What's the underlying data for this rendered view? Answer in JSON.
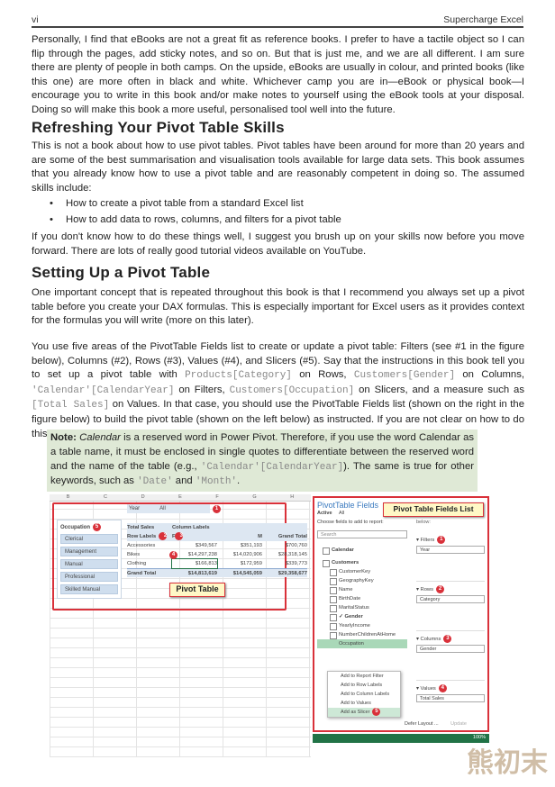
{
  "header": {
    "page": "vi",
    "book_title": "Supercharge Excel"
  },
  "intro_paragraph": "Personally, I find that eBooks are not a great fit as reference books. I prefer to have a tactile object so I can flip through the pages, add sticky notes, and so on. But that is just me, and we are all different. I am sure there are plenty of people in both camps. On the upside, eBooks are usually in colour, and printed books (like this one) are more often in black and white. Whichever camp you are in—eBook or physical book—I encourage you to write in this book and/or make notes to yourself using the eBook tools at your disposal. Doing so will make this book a more useful, personalised tool well into the future.",
  "section1": {
    "heading": "Refreshing Your Pivot Table Skills",
    "paragraph": "This is not a book about how to use pivot tables. Pivot tables have been around for more than 20 years and are some of the best summarisation and visualisation tools available for large data sets. This book assumes that you already know how to use a pivot table and are reasonably competent in doing so. The assumed skills include:",
    "bullets": [
      "How to create a pivot table from a standard Excel list",
      "How to add data to rows, columns, and filters for a pivot table"
    ],
    "paragraph2": "If you don't know how to do these things well, I suggest you brush up on your skills now before you move forward. There are lots of really good tutorial videos available on YouTube."
  },
  "section2": {
    "heading": "Setting Up a Pivot Table",
    "paragraph1": "One important concept that is repeated throughout this book is that I recommend you always set up a pivot table before you create your DAX formulas. This is especially important for Excel users as it provides context for the formulas you will write (more on this later).",
    "p2": {
      "a": "You use five areas of the PivotTable Fields list to create or update a pivot table: Filters (see #1 in the figure below), Columns (#2), Rows (#3), Values (#4), and Slicers (#5). Say that the instructions in this book tell you to set up a pivot table with ",
      "c1": "Products[Category]",
      "b": " on Rows, ",
      "c2": "Customers[Gender]",
      "c": " on Columns, ",
      "c3": "'Calendar'[CalendarYear]",
      "d": " on Filters, ",
      "c4": "Customers[Occupation]",
      "e": " on Slicers, and a measure such as ",
      "c5": "[Total Sales]",
      "f": " on Values. In that case, you should use the PivotTable Fields list (shown on the right in the figure below) to build the pivot table (shown on the left below) as instructed. If you are not clear on how to do this, then you should definitely brush up on building pivot tables before proceeding."
    }
  },
  "note": {
    "label": "Note:",
    "word": "Calendar",
    "a": " is a reserved word in Power Pivot. Therefore, if you use the word Calendar as a table name, it must be enclosed in single quotes to differentiate between the reserved word and the name of the table (e.g., ",
    "c1": "'Calendar'[CalendarYear]",
    "b": "). The same is true for other keywords, such as ",
    "c2": "'Date'",
    "c": " and ",
    "c3": "'Month'",
    "d": "."
  },
  "figure": {
    "columns": [
      "B",
      "C",
      "D",
      "E",
      "F",
      "G",
      "H"
    ],
    "filter": {
      "label": "Year",
      "value": "All",
      "badge": "1"
    },
    "slicer": {
      "title": "Occupation",
      "badge": "5",
      "items": [
        "Clerical",
        "Management",
        "Manual",
        "Professional",
        "Skilled Manual"
      ]
    },
    "pivot": {
      "values_label": "Total Sales",
      "column_labels": "Column Labels",
      "column_badge": "3",
      "row_labels": "Row Labels",
      "row_badge": "2",
      "value_badge": "4",
      "headers": [
        "F",
        "M",
        "Grand Total"
      ],
      "rows": [
        [
          "Accessories",
          "$349,567",
          "$351,193",
          "$700,760"
        ],
        [
          "Bikes",
          "$14,297,238",
          "$14,020,906",
          "$28,318,145"
        ],
        [
          "Clothing",
          "$166,813",
          "$172,959",
          "$339,773"
        ]
      ],
      "total": [
        "Grand Total",
        "$14,813,619",
        "$14,545,059",
        "$29,358,677"
      ]
    },
    "pivot_callout": "Pivot Table",
    "fields_callout": "Pivot Table Fields List",
    "pane": {
      "title": "PivotTable Fields",
      "tabs": [
        "Active",
        "All"
      ],
      "choose": "Choose fields to add to report:",
      "search": "Search",
      "below": "below:",
      "tables": [
        "Calendar",
        "Customers"
      ],
      "fields": [
        {
          "name": "CustomerKey",
          "checked": false
        },
        {
          "name": "GeographyKey",
          "checked": false
        },
        {
          "name": "Name",
          "checked": false
        },
        {
          "name": "BirthDate",
          "checked": false
        },
        {
          "name": "MaritalStatus",
          "checked": false
        },
        {
          "name": "Gender",
          "checked": true
        },
        {
          "name": "YearlyIncome",
          "checked": false
        },
        {
          "name": "NumberChildrenAtHome",
          "checked": false
        }
      ],
      "selected_field": "Occupation",
      "menu": [
        "Add to Report Filter",
        "Add to Row Labels",
        "Add to Column Labels",
        "Add to Values",
        "Add as Slicer"
      ],
      "menu_badge": "5",
      "areas": [
        {
          "label": "Filters",
          "badge": "1",
          "value": "Year"
        },
        {
          "label": "Rows",
          "badge": "2",
          "value": "Category"
        },
        {
          "label": "Columns",
          "badge": "3",
          "value": "Gender"
        },
        {
          "label": "Values",
          "badge": "4",
          "value": "Total Sales"
        }
      ],
      "defer": "Defer Layout ...",
      "update": "Update",
      "zoom": "100%"
    }
  },
  "watermark": "熊初末",
  "colors": {
    "note_bg": "#dfe9d6",
    "callout_border": "#d9313a",
    "callout_bg": "#fff8c6",
    "excel_green": "#217346"
  }
}
